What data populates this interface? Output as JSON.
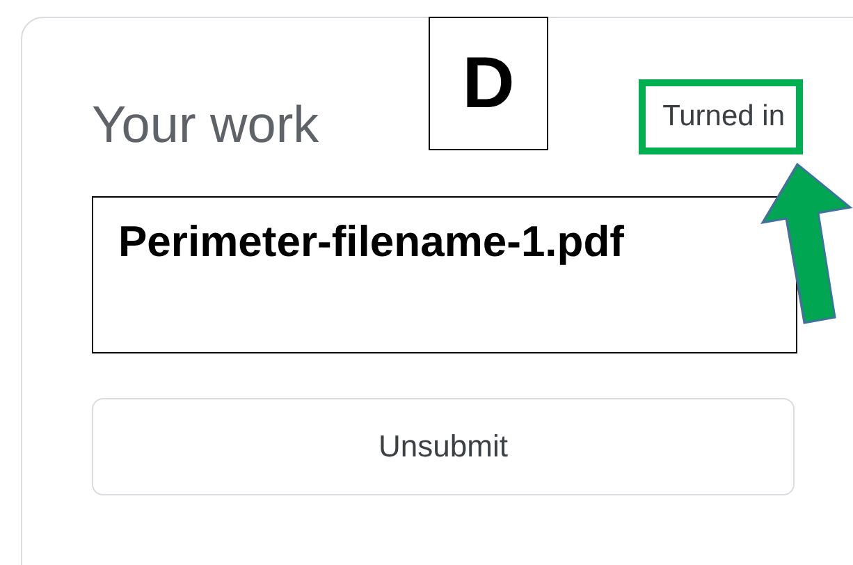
{
  "card": {
    "title": "Your work",
    "status": "Turned in"
  },
  "annotation": {
    "label": "D"
  },
  "file": {
    "name": "Perimeter-filename-1.pdf"
  },
  "buttons": [
    {
      "label": "Unsubmit"
    }
  ]
}
